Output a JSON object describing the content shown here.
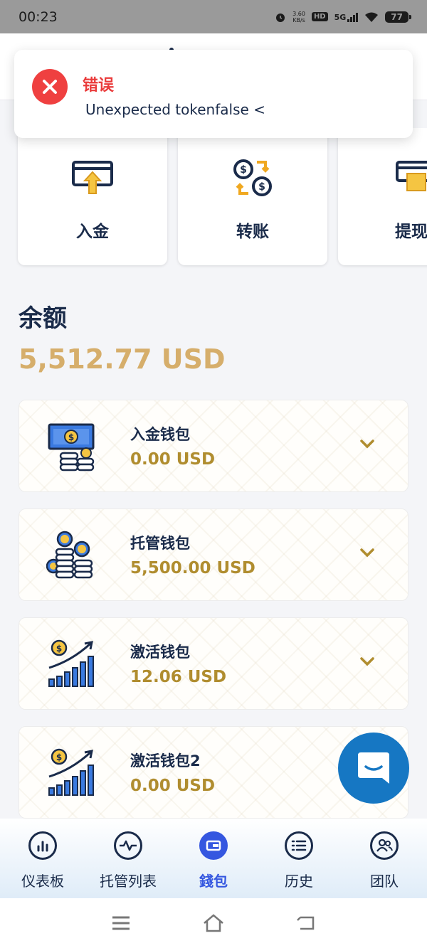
{
  "status_bar": {
    "time": "00:23",
    "net_speed_value": "3.60",
    "net_speed_unit": "KB/s",
    "hd": "HD",
    "network": "5G",
    "battery": "77"
  },
  "toast": {
    "title": "错误",
    "message": "Unexpected tokenfalse <",
    "icon": "close-icon",
    "color": "#ef4040"
  },
  "actions": [
    {
      "label": "入金",
      "icon": "deposit-icon"
    },
    {
      "label": "转账",
      "icon": "transfer-icon"
    },
    {
      "label": "提现",
      "icon": "withdraw-icon"
    }
  ],
  "balance": {
    "title": "余额",
    "amount": "5,512.77 USD",
    "color": "#d6ae6b"
  },
  "wallets": [
    {
      "name": "入金钱包",
      "amount": "0.00 USD",
      "icon": "cash-icon"
    },
    {
      "name": "托管钱包",
      "amount": "5,500.00 USD",
      "icon": "coins-stack-icon"
    },
    {
      "name": "激活钱包",
      "amount": "12.06 USD",
      "icon": "growth-chart-icon"
    },
    {
      "name": "激活钱包2",
      "amount": "0.00 USD",
      "icon": "growth-chart-icon"
    }
  ],
  "bottom_nav": [
    {
      "label": "仪表板",
      "icon": "dashboard-icon"
    },
    {
      "label": "托管列表",
      "icon": "pulse-icon"
    },
    {
      "label": "錢包",
      "icon": "wallet-icon",
      "active": true
    },
    {
      "label": "历史",
      "icon": "list-icon"
    },
    {
      "label": "团队",
      "icon": "team-icon"
    }
  ],
  "colors": {
    "navy": "#1a2b4a",
    "gold": "#d6ae6b",
    "accent_blue": "#3557e0",
    "chat_blue": "#1677c3"
  }
}
